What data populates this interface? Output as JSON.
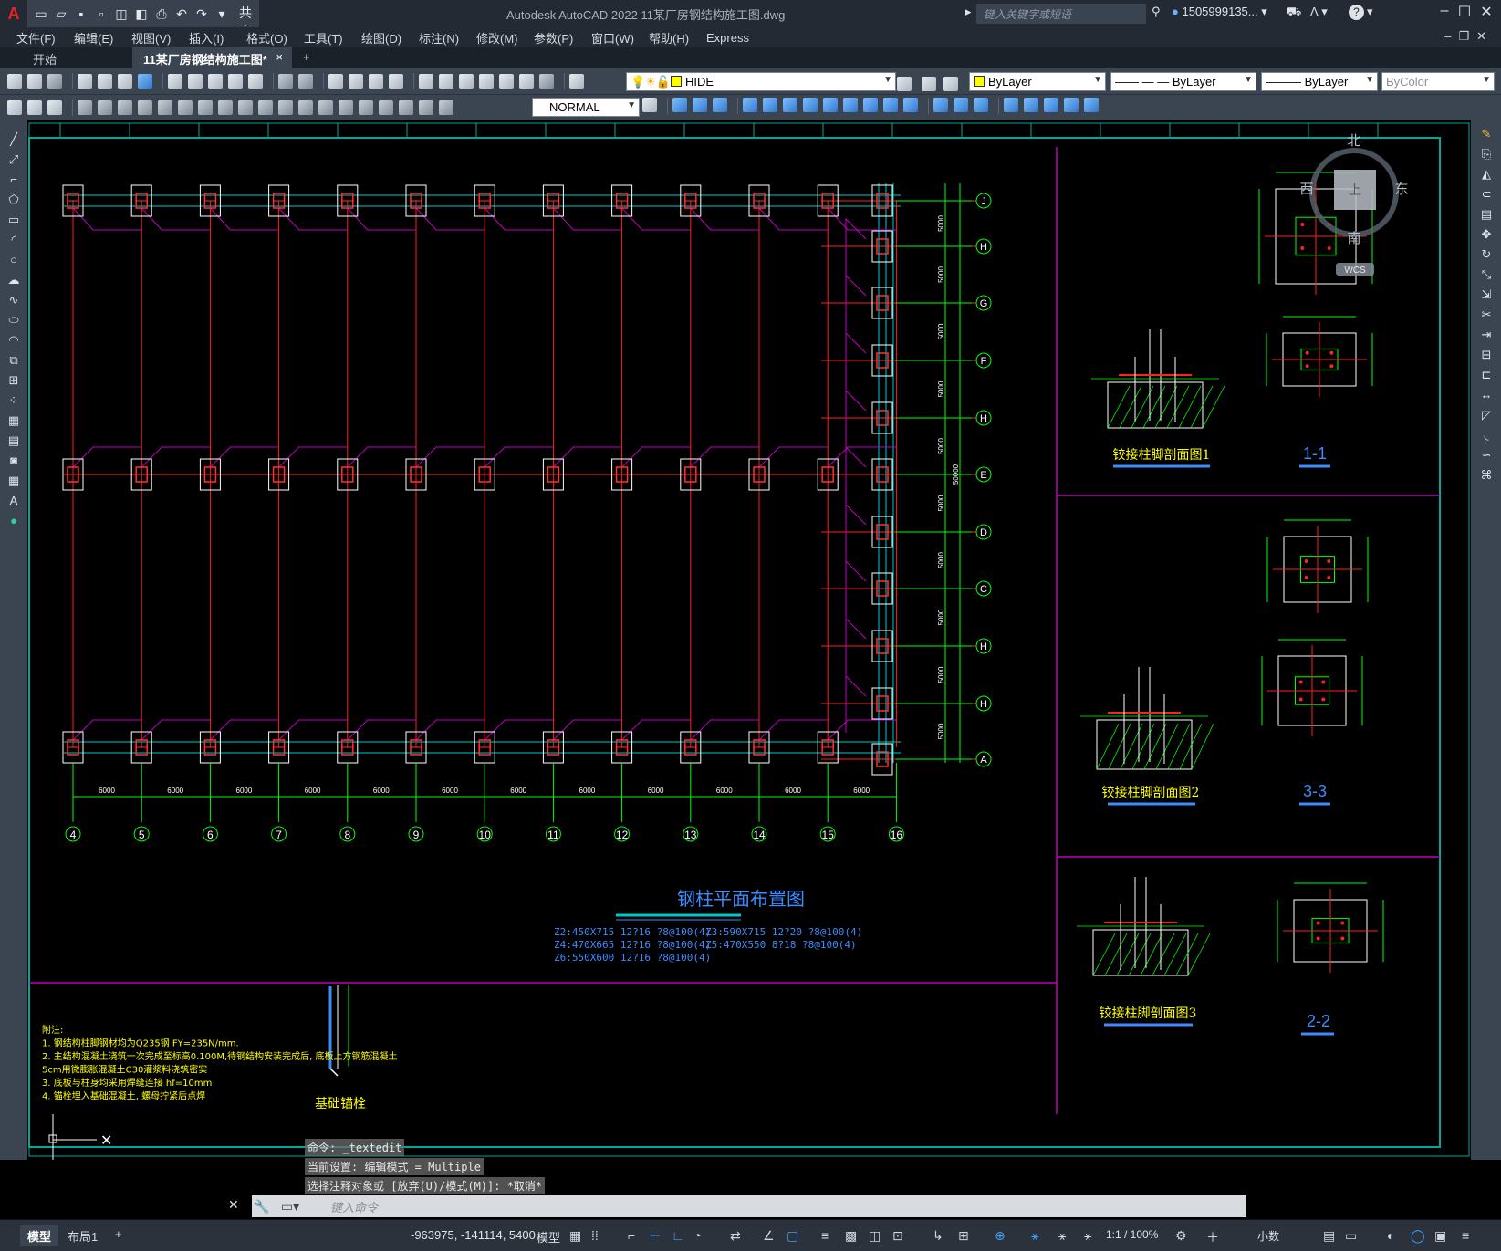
{
  "app": {
    "logo": "A",
    "share_label": "共享",
    "title": "Autodesk AutoCAD 2022    11某厂房钢结构施工图.dwg",
    "search_placeholder": "键入关键字或短语",
    "user": "1505999135...",
    "help_icon": "?"
  },
  "menu": [
    "文件(F)",
    "编辑(E)",
    "视图(V)",
    "插入(I)",
    "格式(O)",
    "工具(T)",
    "绘图(D)",
    "标注(N)",
    "修改(M)",
    "参数(P)",
    "窗口(W)",
    "帮助(H)",
    "Express"
  ],
  "tabs": {
    "start": "开始",
    "active": "11某厂房钢结构施工图*",
    "close": "×",
    "new": "+"
  },
  "toolbar": {
    "layer_value": "HIDE",
    "color_value": "ByLayer",
    "linetype_value": "—— — — ByLayer",
    "lineweight_value": "——— ByLayer",
    "plotstyle_value": "ByColor",
    "dimstyle_value": "NORMAL"
  },
  "drawing": {
    "main_title": "钢柱平面布置图",
    "notes_legend": [
      "Z2:450X715 12?16 ?8@100(4)",
      "Z4:470X665 12?16 ?8@100(4)",
      "Z6:550X600 12?16 ?8@100(4)",
      "Z3:590X715 12?20 ?8@100(4)",
      "Z5:470X550 8?18 ?8@100(4)"
    ],
    "grid_x": [
      "4",
      "5",
      "6",
      "7",
      "8",
      "9",
      "10",
      "11",
      "12",
      "13",
      "14",
      "15",
      "16"
    ],
    "grid_y": [
      "J",
      "H",
      "G",
      "F",
      "H",
      "E",
      "D",
      "C",
      "H",
      "H",
      "A"
    ],
    "bay_dim": "6000",
    "span_dim": "5000",
    "total_dim": "50000",
    "detail_titles": [
      "铰接柱脚剖面图1",
      "1-1",
      "铰接柱脚剖面图2",
      "3-3",
      "铰接柱脚剖面图3",
      "2-2"
    ],
    "anchor_title": "基础锚栓",
    "general_notes": [
      "附注:",
      "1. 钢结构柱脚钢材均为Q235钢 FY=235N/mm.",
      "2. 主结构混凝土浇筑一次完成至标高0.100M,待钢结构安装完成后, 底板上方钢筋混凝土",
      "   5cm用微膨胀混凝土C30灌浆料浇筑密实",
      "3. 底板与柱身均采用焊缝连接 hf=10mm",
      "4. 锚栓埋入基础混凝土, 螺母拧紧后点焊"
    ],
    "compass": {
      "north": "北",
      "south": "南",
      "east": "东",
      "west": "西",
      "top_face": "上",
      "wcs": "WCS"
    }
  },
  "command": {
    "history": [
      "命令: _textedit",
      "当前设置: 编辑模式 = Multiple",
      "选择注释对象或 [放弃(U)/模式(M)]: *取消*"
    ],
    "placeholder": "键入命令"
  },
  "status": {
    "tabs": [
      "模型",
      "布局1",
      "+"
    ],
    "coords": "-963975, -141114, 5400",
    "model_label": "模型",
    "scale": "1:1 / 100%",
    "units": "小数"
  }
}
